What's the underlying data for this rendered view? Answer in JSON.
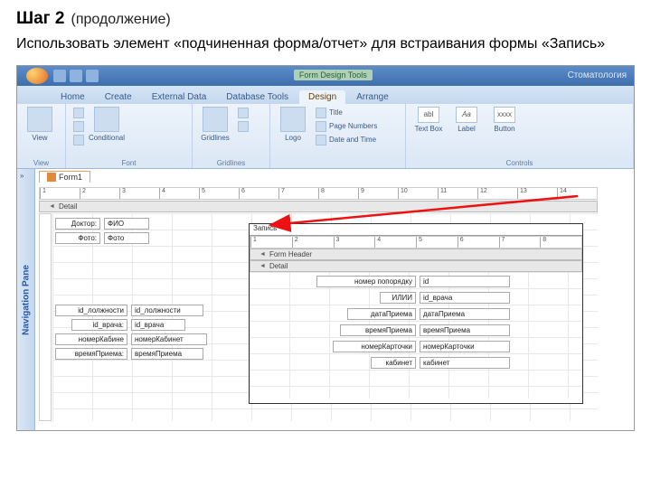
{
  "slide": {
    "step": "Шаг 2",
    "subtitle": "(продолжение)",
    "description": "Использовать элемент «подчиненная форма/отчет» для встраивания формы  «Запись»"
  },
  "window": {
    "tools_context": "Form Design Tools",
    "app_title_right": "Стоматология"
  },
  "ribbon": {
    "tabs": [
      "Home",
      "Create",
      "External Data",
      "Database Tools",
      "Design",
      "Arrange"
    ],
    "active_tab": "Design",
    "groups": {
      "view": "View",
      "font": "Font",
      "gridlines": "Gridlines",
      "controls": "Controls"
    },
    "buttons": {
      "view": "View",
      "conditional": "Conditional",
      "gridlines": "Gridlines",
      "logo": "Logo",
      "title": "Title",
      "page_numbers": "Page Numbers",
      "date_time": "Date and Time",
      "text_box": "Text Box",
      "label": "Label",
      "button": "Button",
      "abl": "abl",
      "Aa": "Aa",
      "xxxx": "xxxx"
    }
  },
  "form": {
    "tab_name": "Form1",
    "ruler_outer": [
      "1",
      "2",
      "3",
      "4",
      "5",
      "6",
      "7",
      "8",
      "9",
      "10",
      "11",
      "12",
      "13",
      "14"
    ],
    "sections": {
      "detail": "Detail",
      "form_header": "Form Header"
    },
    "fields": {
      "doctor_label": "Доктор:",
      "doctor_value": "ФИО",
      "photo_label": "Фото:",
      "photo_value": "Фото",
      "id_dolzh_label": "id_лолжности",
      "id_dolzh_value": "id_лолжности",
      "id_vracha_label": "id_врача:",
      "id_vracha_value": "id_врача",
      "nomerKab_label": "номерКабине",
      "nomerKab_value": "номерКабинет",
      "vremyaPriema_label": "времяПриема:",
      "vremyaPriema_value": "времяПриема"
    },
    "subform": {
      "title": "Запись",
      "ruler": [
        "1",
        "2",
        "3",
        "4",
        "5",
        "6",
        "7",
        "8"
      ],
      "rows": [
        {
          "label": "номер попорядку",
          "value": "id"
        },
        {
          "label": "ИЛИИ",
          "value": "id_врача"
        },
        {
          "label": "датаПриема",
          "value": "датаПриема"
        },
        {
          "label": "времяПриема",
          "value": "времяПриема"
        },
        {
          "label": "номерКарточки",
          "value": "номерКарточки"
        },
        {
          "label": "кабинет",
          "value": "кабинет"
        }
      ]
    }
  },
  "nav": {
    "label": "Navigation Pane",
    "toggle": "»"
  }
}
